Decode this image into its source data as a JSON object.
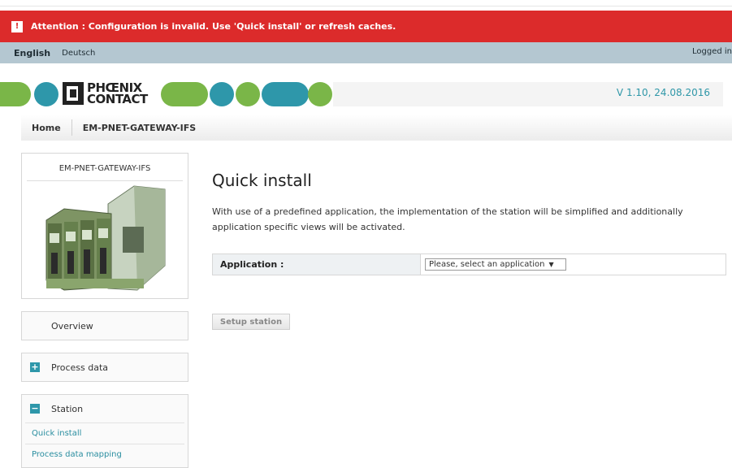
{
  "alert": {
    "icon": "exclamation-icon",
    "icon_glyph": "!",
    "message": "Attention : Configuration is invalid. Use 'Quick install' or refresh caches."
  },
  "lang": {
    "english": "English",
    "deutsch": "Deutsch",
    "login": "Logged in"
  },
  "brand": {
    "logo_line1": "PHŒNIX",
    "logo_line2": "CONTACT",
    "version": "V 1.10, 24.08.2016"
  },
  "breadcrumb": {
    "home": "Home",
    "device": "EM-PNET-GATEWAY-IFS"
  },
  "device": {
    "name": "EM-PNET-GATEWAY-IFS"
  },
  "nav": {
    "overview": "Overview",
    "process_data": {
      "toggle": "+",
      "label": "Process data"
    },
    "station": {
      "toggle": "−",
      "label": "Station",
      "items": [
        "Quick install",
        "Process data mapping"
      ]
    }
  },
  "main": {
    "title": "Quick install",
    "description": "With use of a predefined application, the implementation of the station will be simplified and additionally application specific views will be activated.",
    "application_label": "Application :",
    "application_select": "Please, select an application",
    "setup_button": "Setup station"
  },
  "colors": {
    "alert": "#dc2b2b",
    "accent": "#2e97aa",
    "green": "#7ab648",
    "teal": "#2e97aa"
  }
}
